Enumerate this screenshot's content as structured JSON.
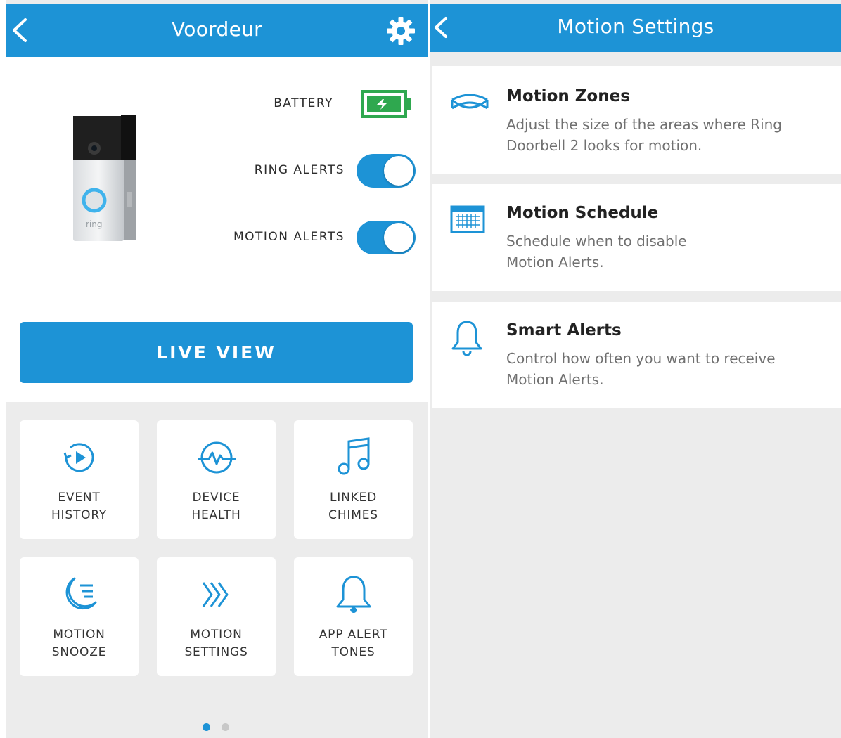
{
  "left": {
    "header": {
      "title": "Voordeur"
    },
    "battery": {
      "label": "BATTERY"
    },
    "ring_alerts": {
      "label": "RING ALERTS",
      "on": true
    },
    "motion_alerts": {
      "label": "MOTION ALERTS",
      "on": true
    },
    "live_view": {
      "label": "LIVE VIEW"
    },
    "doorbell_brand": "ring",
    "tiles": [
      {
        "label": "EVENT\nHISTORY",
        "icon": "play-history-icon"
      },
      {
        "label": "DEVICE\nHEALTH",
        "icon": "pulse-icon"
      },
      {
        "label": "LINKED\nCHIMES",
        "icon": "music-note-icon"
      },
      {
        "label": "MOTION\nSNOOZE",
        "icon": "moon-snooze-icon"
      },
      {
        "label": "MOTION\nSETTINGS",
        "icon": "chevrons-right-icon"
      },
      {
        "label": "APP ALERT\nTONES",
        "icon": "bell-icon"
      }
    ],
    "pager": {
      "count": 2,
      "active": 0
    }
  },
  "right": {
    "header": {
      "title": "Motion Settings"
    },
    "items": [
      {
        "title": "Motion Zones",
        "desc": "Adjust the size of the areas where Ring\nDoorbell 2 looks for motion.",
        "icon": "motion-zones-icon"
      },
      {
        "title": "Motion Schedule",
        "desc": "Schedule when to disable\nMotion Alerts.",
        "icon": "calendar-icon"
      },
      {
        "title": "Smart Alerts",
        "desc": "Control how often you want to receive\nMotion Alerts.",
        "icon": "bell-icon"
      }
    ]
  },
  "colors": {
    "accent": "#1d93d6",
    "battery_green": "#2fa84f",
    "background": "#ececec"
  }
}
